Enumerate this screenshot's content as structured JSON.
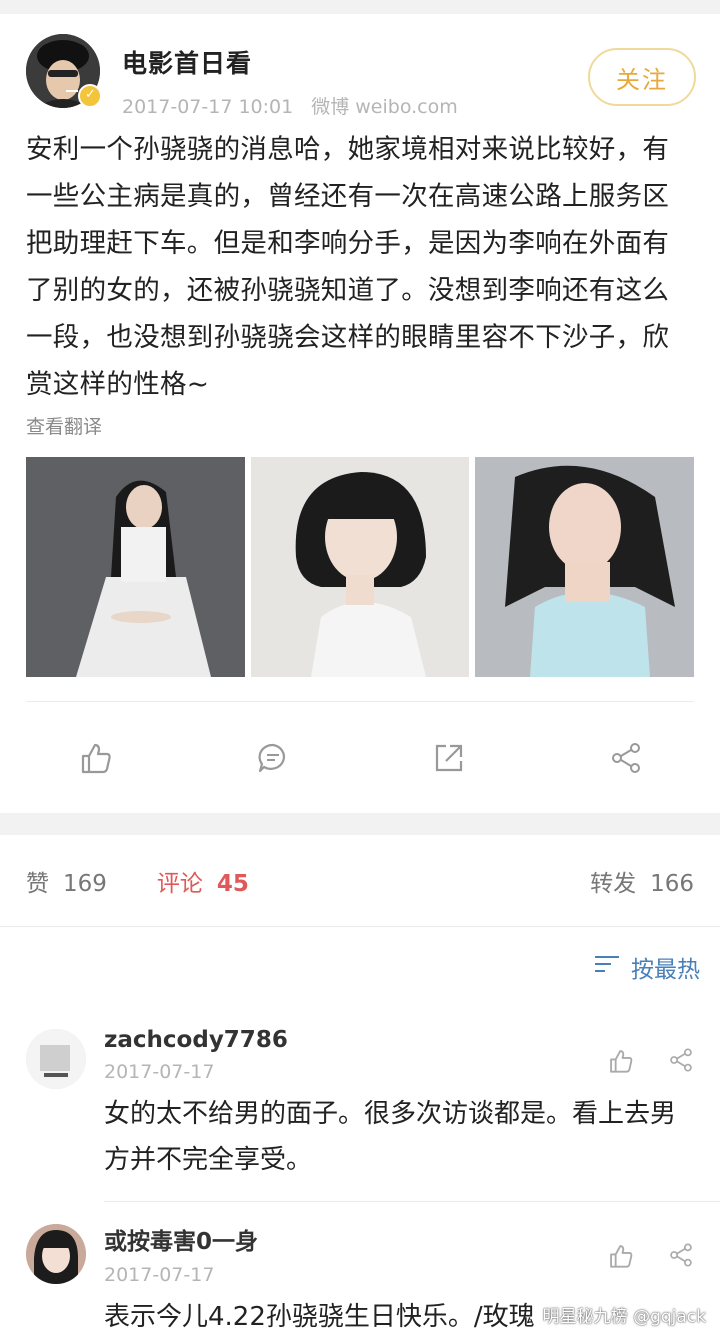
{
  "post": {
    "author": "电影首日看",
    "date": "2017-07-17 10:01",
    "source": "微博 weibo.com",
    "follow_label": "关注",
    "text": "安利一个孙骁骁的消息哈，她家境相对来说比较好，有一些公主病是真的，曾经还有一次在高速公路上服务区把助理赶下车。但是和李响分手，是因为李响在外面有了别的女的，还被孙骁骁知道了。没想到李响还有这么一段，也没想到孙骁骁会这样的眼睛里容不下沙子，欣赏这样的性格~",
    "translate_label": "查看翻译",
    "photos": [
      "photo-1",
      "photo-2",
      "photo-3"
    ],
    "actions": [
      "like-icon",
      "comment-icon",
      "repost-icon",
      "share-icon"
    ]
  },
  "stats": {
    "likes_label": "赞",
    "likes_count": "169",
    "comments_label": "评论",
    "comments_count": "45",
    "reposts_label": "转发",
    "reposts_count": "166"
  },
  "sort": {
    "icon": "sort-icon",
    "label": "按最热"
  },
  "comments": [
    {
      "user": "zachcody7786",
      "date": "2017-07-17",
      "text": "女的太不给男的面子。很多次访谈都是。看上去男方并不完全享受。"
    },
    {
      "user": "或按毒害0一身",
      "date": "2017-07-17",
      "text": "表示今儿4.22孙骁骁生日快乐。/玫瑰"
    }
  ],
  "watermark": "明星秘九榜 @gqjack",
  "colors": {
    "accent_orange": "#e8a93c",
    "comment_red": "#e0585a",
    "link_blue": "#4a80b8",
    "muted_gray": "#b5b5b5"
  }
}
